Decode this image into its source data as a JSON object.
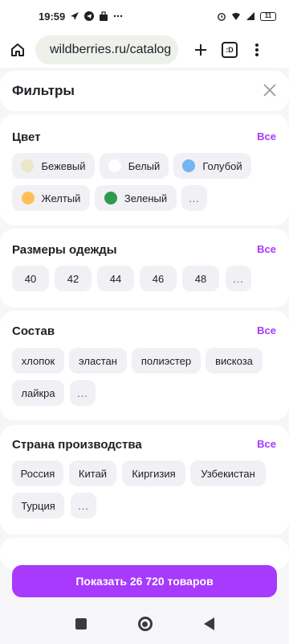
{
  "status_bar": {
    "time": "19:59",
    "battery": "11"
  },
  "browser": {
    "url": "wildberries.ru/catalog",
    "tabs_label": ":D"
  },
  "filters": {
    "title": "Фильтры",
    "all_label": "Все",
    "sections": [
      {
        "title": "Цвет",
        "items": [
          {
            "label": "Бежевый",
            "color": "#ebe6c9"
          },
          {
            "label": "Белый",
            "color": "#ffffff"
          },
          {
            "label": "Голубой",
            "color": "#73b4f2"
          },
          {
            "label": "Желтый",
            "color": "#fec054"
          },
          {
            "label": "Зеленый",
            "color": "#2e9a4f"
          }
        ],
        "more": "..."
      },
      {
        "title": "Размеры одежды",
        "items": [
          {
            "label": "40"
          },
          {
            "label": "42"
          },
          {
            "label": "44"
          },
          {
            "label": "46"
          },
          {
            "label": "48"
          }
        ],
        "more": "..."
      },
      {
        "title": "Состав",
        "items": [
          {
            "label": "хлопок"
          },
          {
            "label": "эластан"
          },
          {
            "label": "полиэстер"
          },
          {
            "label": "вискоза"
          },
          {
            "label": "лайкра"
          }
        ],
        "more": "..."
      },
      {
        "title": "Страна производства",
        "items": [
          {
            "label": "Россия"
          },
          {
            "label": "Китай"
          },
          {
            "label": "Киргизия"
          },
          {
            "label": "Узбекистан"
          },
          {
            "label": "Турция"
          }
        ],
        "more": "..."
      }
    ]
  },
  "cta": {
    "label": "Показать 26 720 товаров"
  },
  "colors": {
    "accent": "#a73afd"
  }
}
